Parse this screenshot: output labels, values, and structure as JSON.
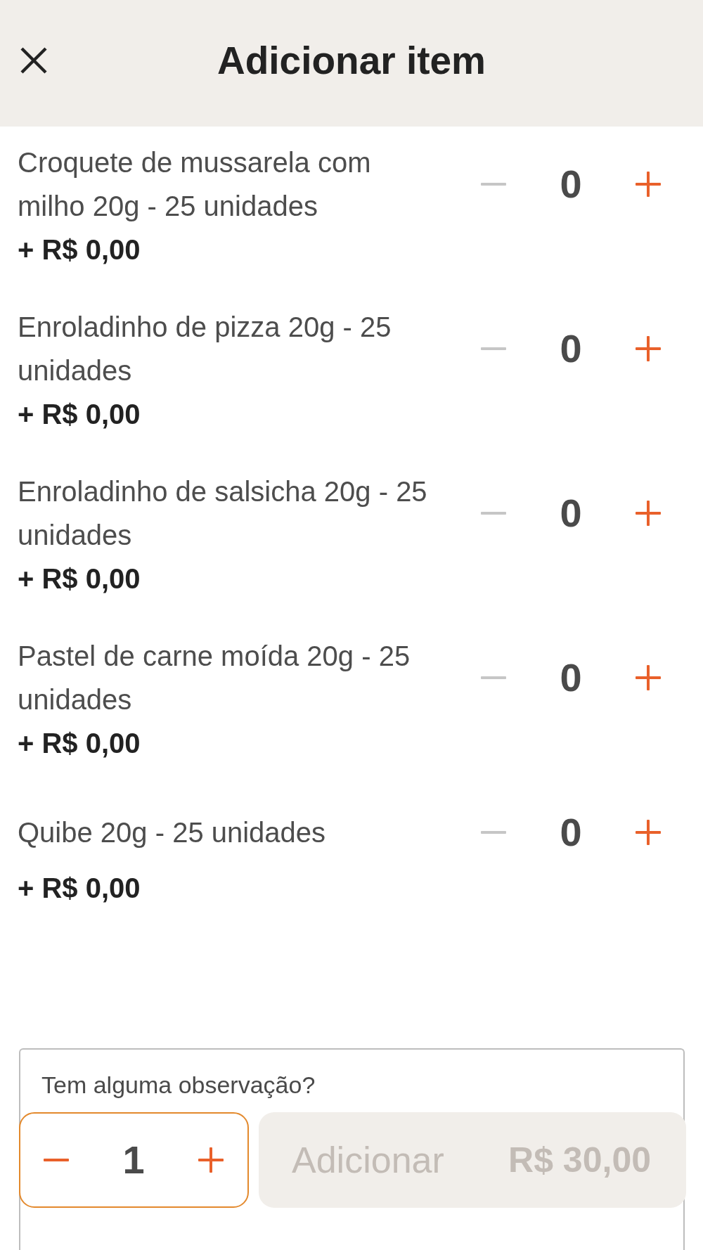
{
  "header": {
    "title": "Adicionar item"
  },
  "items": [
    {
      "name": "Croquete de mussarela com milho 20g - 25 unidades",
      "price": "+ R$ 0,00",
      "quantity": "0",
      "decrease_disabled": true
    },
    {
      "name": "Enroladinho de pizza 20g - 25 unidades",
      "price": "+ R$ 0,00",
      "quantity": "0",
      "decrease_disabled": true
    },
    {
      "name": "Enroladinho de salsicha 20g - 25 unidades",
      "price": "+ R$ 0,00",
      "quantity": "0",
      "decrease_disabled": true
    },
    {
      "name": "Pastel de carne moída 20g - 25 unidades",
      "price": "+ R$ 0,00",
      "quantity": "0",
      "decrease_disabled": true
    },
    {
      "name": "Quibe 20g - 25 unidades",
      "price": "+ R$ 0,00",
      "quantity": "0",
      "decrease_disabled": true
    }
  ],
  "observation": {
    "placeholder": "Tem alguma observação?"
  },
  "footer": {
    "quantity": "1",
    "decrease_disabled": false,
    "add_button": {
      "label": "Adicionar",
      "price": "R$ 30,00",
      "disabled": true
    }
  }
}
